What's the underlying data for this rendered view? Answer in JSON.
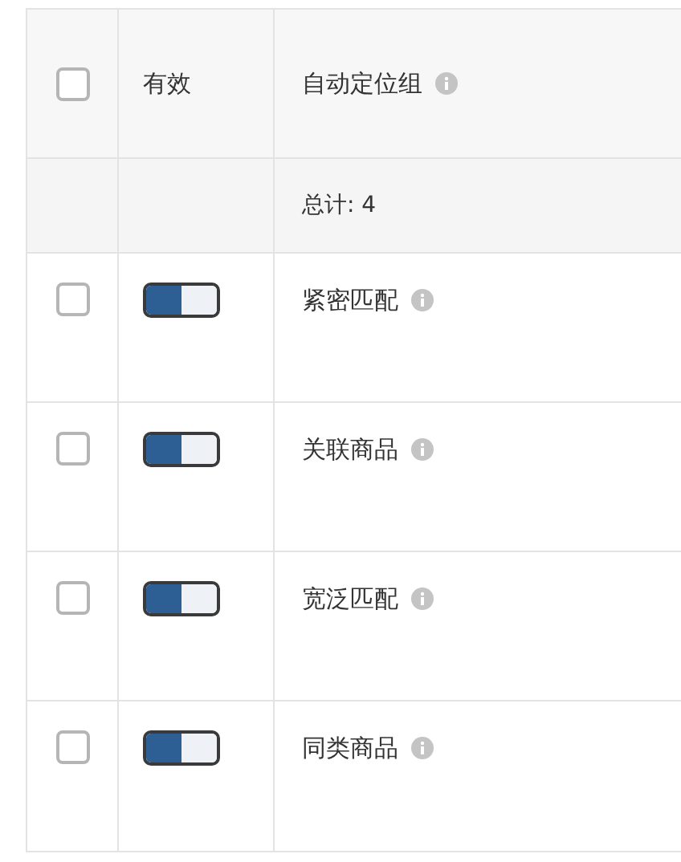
{
  "table": {
    "header": {
      "select_all_checked": false,
      "columns": [
        "有效",
        "自动定位组"
      ]
    },
    "total_row": {
      "label": "总计: 4"
    },
    "rows": [
      {
        "checked": false,
        "enabled": true,
        "group": "紧密匹配"
      },
      {
        "checked": false,
        "enabled": true,
        "group": "关联商品"
      },
      {
        "checked": false,
        "enabled": true,
        "group": "宽泛匹配"
      },
      {
        "checked": false,
        "enabled": true,
        "group": "同类商品"
      }
    ]
  }
}
